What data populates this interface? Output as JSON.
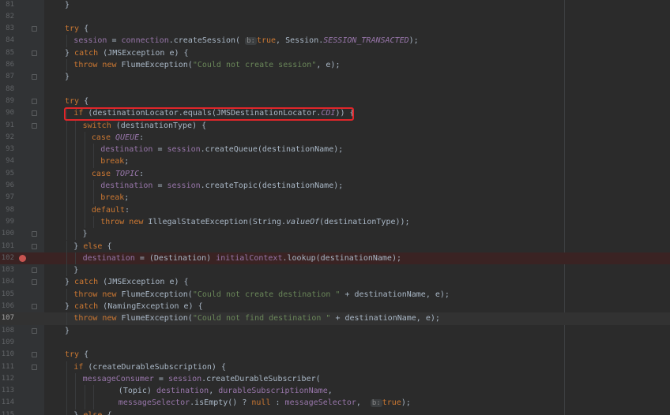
{
  "editor": {
    "lines": [
      {
        "num": "81",
        "indent": 0,
        "tokens": [
          [
            "p",
            "}"
          ]
        ]
      },
      {
        "num": "82",
        "indent": 0,
        "tokens": []
      },
      {
        "num": "83",
        "indent": 0,
        "tokens": [
          [
            "kw",
            "try"
          ],
          [
            "p",
            " {"
          ]
        ]
      },
      {
        "num": "84",
        "indent": 1,
        "tokens": [
          [
            "var",
            "session"
          ],
          [
            "p",
            " = "
          ],
          [
            "var",
            "connection"
          ],
          [
            "p",
            "."
          ],
          [
            "p",
            "createSession"
          ],
          [
            "p",
            "( "
          ],
          [
            "hint",
            "b:"
          ],
          [
            "kw",
            "true"
          ],
          [
            "p",
            ", Session."
          ],
          [
            "const",
            "SESSION_TRANSACTED"
          ],
          [
            "p",
            ");"
          ]
        ]
      },
      {
        "num": "85",
        "indent": 0,
        "tokens": [
          [
            "p",
            "} "
          ],
          [
            "kw",
            "catch"
          ],
          [
            "p",
            " (JMSException e) {"
          ]
        ]
      },
      {
        "num": "86",
        "indent": 1,
        "tokens": [
          [
            "kw",
            "throw new"
          ],
          [
            "p",
            " FlumeException("
          ],
          [
            "str",
            "\"Could not create session\""
          ],
          [
            "p",
            ", e);"
          ]
        ]
      },
      {
        "num": "87",
        "indent": 0,
        "tokens": [
          [
            "p",
            "}"
          ]
        ]
      },
      {
        "num": "88",
        "indent": 0,
        "tokens": []
      },
      {
        "num": "89",
        "indent": 0,
        "tokens": [
          [
            "kw",
            "try"
          ],
          [
            "p",
            " {"
          ]
        ]
      },
      {
        "num": "90",
        "indent": 1,
        "tokens": [
          [
            "kw",
            "if"
          ],
          [
            "p",
            " (destinationLocator.equals(JMSDestinationLocator."
          ],
          [
            "const",
            "CDI"
          ],
          [
            "p",
            ")) {"
          ]
        ]
      },
      {
        "num": "91",
        "indent": 2,
        "tokens": [
          [
            "kw",
            "switch"
          ],
          [
            "p",
            " (destinationType) {"
          ]
        ]
      },
      {
        "num": "92",
        "indent": 3,
        "tokens": [
          [
            "kw",
            "case"
          ],
          [
            "p",
            " "
          ],
          [
            "const",
            "QUEUE"
          ],
          [
            "p",
            ":"
          ]
        ]
      },
      {
        "num": "93",
        "indent": 4,
        "tokens": [
          [
            "var",
            "destination"
          ],
          [
            "p",
            " = "
          ],
          [
            "var",
            "session"
          ],
          [
            "p",
            ".createQueue(destinationName);"
          ]
        ]
      },
      {
        "num": "94",
        "indent": 4,
        "tokens": [
          [
            "kw",
            "break"
          ],
          [
            "p",
            ";"
          ]
        ]
      },
      {
        "num": "95",
        "indent": 3,
        "tokens": [
          [
            "kw",
            "case"
          ],
          [
            "p",
            " "
          ],
          [
            "const",
            "TOPIC"
          ],
          [
            "p",
            ":"
          ]
        ]
      },
      {
        "num": "96",
        "indent": 4,
        "tokens": [
          [
            "var",
            "destination"
          ],
          [
            "p",
            " = "
          ],
          [
            "var",
            "session"
          ],
          [
            "p",
            ".createTopic(destinationName);"
          ]
        ]
      },
      {
        "num": "97",
        "indent": 4,
        "tokens": [
          [
            "kw",
            "break"
          ],
          [
            "p",
            ";"
          ]
        ]
      },
      {
        "num": "98",
        "indent": 3,
        "tokens": [
          [
            "kw",
            "default"
          ],
          [
            "p",
            ":"
          ]
        ]
      },
      {
        "num": "99",
        "indent": 4,
        "tokens": [
          [
            "kw",
            "throw new"
          ],
          [
            "p",
            " IllegalStateException(String."
          ],
          [
            "it",
            "valueOf"
          ],
          [
            "p",
            "(destinationType));"
          ]
        ]
      },
      {
        "num": "100",
        "indent": 2,
        "tokens": [
          [
            "p",
            "}"
          ]
        ]
      },
      {
        "num": "101",
        "indent": 1,
        "tokens": [
          [
            "p",
            "} "
          ],
          [
            "kw",
            "else"
          ],
          [
            "p",
            " {"
          ]
        ]
      },
      {
        "num": "102",
        "indent": 2,
        "breakpoint": true,
        "tokens": [
          [
            "var",
            "destination"
          ],
          [
            "p",
            " = (Destination) "
          ],
          [
            "var",
            "initialContext"
          ],
          [
            "p",
            ".lookup(destinationName);"
          ]
        ]
      },
      {
        "num": "103",
        "indent": 1,
        "tokens": [
          [
            "p",
            "}"
          ]
        ]
      },
      {
        "num": "104",
        "indent": 0,
        "tokens": [
          [
            "p",
            "} "
          ],
          [
            "kw",
            "catch"
          ],
          [
            "p",
            " (JMSException e) {"
          ]
        ]
      },
      {
        "num": "105",
        "indent": 1,
        "tokens": [
          [
            "kw",
            "throw new"
          ],
          [
            "p",
            " FlumeException("
          ],
          [
            "str",
            "\"Could not create destination \""
          ],
          [
            "p",
            " + destinationName, e);"
          ]
        ]
      },
      {
        "num": "106",
        "indent": 0,
        "tokens": [
          [
            "p",
            "} "
          ],
          [
            "kw",
            "catch"
          ],
          [
            "p",
            " (NamingException e) {"
          ]
        ]
      },
      {
        "num": "107",
        "indent": 1,
        "current": true,
        "tokens": [
          [
            "kw",
            "throw new"
          ],
          [
            "p",
            " FlumeException("
          ],
          [
            "str",
            "\"Could not find destination \""
          ],
          [
            "p",
            " + destinationName, e);"
          ]
        ]
      },
      {
        "num": "108",
        "indent": 0,
        "tokens": [
          [
            "p",
            "}"
          ]
        ]
      },
      {
        "num": "109",
        "indent": 0,
        "tokens": []
      },
      {
        "num": "110",
        "indent": 0,
        "tokens": [
          [
            "kw",
            "try"
          ],
          [
            "p",
            " {"
          ]
        ]
      },
      {
        "num": "111",
        "indent": 1,
        "tokens": [
          [
            "kw",
            "if"
          ],
          [
            "p",
            " (createDurableSubscription) {"
          ]
        ]
      },
      {
        "num": "112",
        "indent": 2,
        "tokens": [
          [
            "var",
            "messageConsumer"
          ],
          [
            "p",
            " = "
          ],
          [
            "var",
            "session"
          ],
          [
            "p",
            ".createDurableSubscriber("
          ]
        ]
      },
      {
        "num": "113",
        "indent": 6,
        "tokens": [
          [
            "p",
            "(Topic) "
          ],
          [
            "var",
            "destination"
          ],
          [
            "p",
            ", "
          ],
          [
            "var",
            "durableSubscriptionName"
          ],
          [
            "p",
            ","
          ]
        ]
      },
      {
        "num": "114",
        "indent": 6,
        "tokens": [
          [
            "var",
            "messageSelector"
          ],
          [
            "p",
            ".isEmpty() ? "
          ],
          [
            "kw",
            "null"
          ],
          [
            "p",
            " : "
          ],
          [
            "var",
            "messageSelector"
          ],
          [
            "p",
            ",  "
          ],
          [
            "hint",
            "b:"
          ],
          [
            "kw",
            "true"
          ],
          [
            "p",
            ");"
          ]
        ]
      },
      {
        "num": "115",
        "indent": 1,
        "tokens": [
          [
            "p",
            "} "
          ],
          [
            "kw",
            "else"
          ],
          [
            "p",
            " {"
          ]
        ]
      }
    ]
  },
  "colors": {
    "background": "#2b2b2b",
    "keyword": "#cc7832",
    "string": "#6a8759",
    "field": "#9876aa",
    "highlight_box": "#e0262a",
    "breakpoint": "#c75450"
  }
}
